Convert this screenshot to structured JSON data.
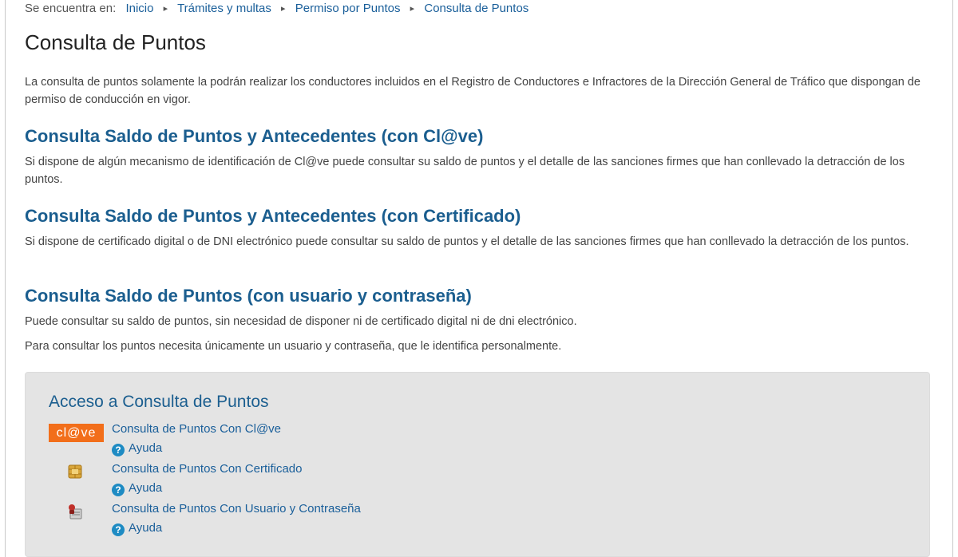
{
  "breadcrumb": {
    "lead": "Se encuentra en:",
    "items": [
      "Inicio",
      "Trámites y multas",
      "Permiso por Puntos",
      "Consulta de Puntos"
    ]
  },
  "page_title": "Consulta de Puntos",
  "intro": "La consulta de puntos solamente la podrán realizar los conductores incluidos en el Registro de Conductores e Infractores de la Dirección General de Tráfico que dispongan de permiso de conducción en vigor.",
  "sections": [
    {
      "title": "Consulta Saldo de Puntos y Antecedentes (con Cl@ve)",
      "text": "Si dispone de algún mecanismo de identificación de Cl@ve puede consultar su saldo de puntos y el detalle de las sanciones firmes que han conllevado la detracción de los puntos."
    },
    {
      "title": "Consulta Saldo de Puntos y Antecedentes (con Certificado)",
      "text": "Si dispone de certificado digital o de DNI electrónico puede consultar su saldo de puntos y el detalle de las sanciones firmes que han conllevado la detracción de los puntos."
    },
    {
      "title": "Consulta Saldo de Puntos (con usuario y contraseña)",
      "text": "Puede consultar su saldo de puntos, sin necesidad de disponer ni de certificado digital ni de dni electrónico.",
      "text2": "Para consultar los puntos necesita únicamente un usuario y contraseña, que le identifica personalmente."
    }
  ],
  "access": {
    "title": "Acceso a Consulta de Puntos",
    "items": [
      {
        "logo_text": "cl@ve",
        "link": "Consulta de Puntos Con Cl@ve",
        "help": "Ayuda",
        "icon": "clave-logo-icon"
      },
      {
        "link": "Consulta de Puntos Con Certificado",
        "help": "Ayuda",
        "icon": "smart-card-chip-icon"
      },
      {
        "link": "Consulta de Puntos Con Usuario y Contraseña",
        "help": "Ayuda",
        "icon": "user-password-icon"
      }
    ],
    "help_glyph": "?"
  },
  "colors": {
    "link": "#1a5f9a",
    "heading": "#1b5e8f",
    "clave_orange": "#f26e1a",
    "help_blue": "#1e8bc3",
    "box_bg": "#e4e4e4"
  }
}
